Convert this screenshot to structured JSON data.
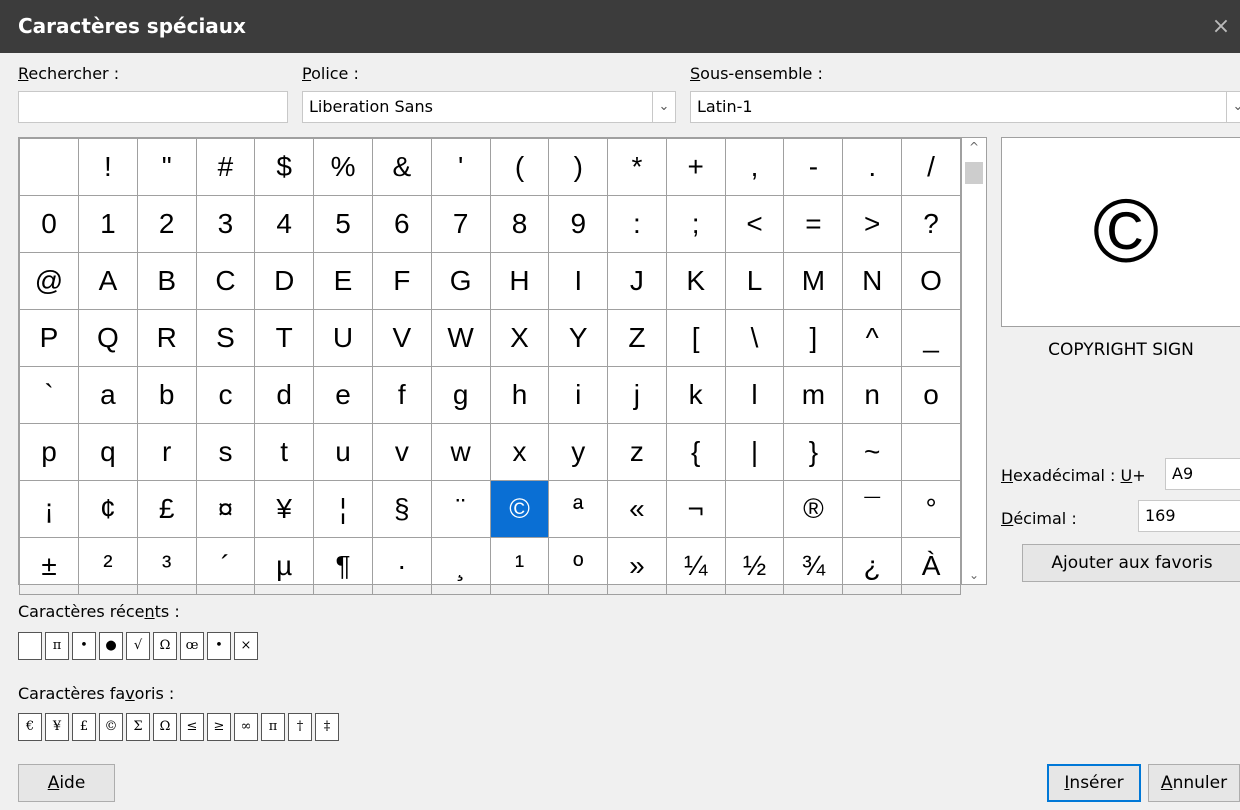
{
  "window": {
    "title": "Caractères spéciaux",
    "close_glyph": "×"
  },
  "search": {
    "label_pre": "",
    "label_u": "R",
    "label_post": "echercher :",
    "value": ""
  },
  "font": {
    "label_u": "P",
    "label_post": "olice :",
    "value": "Liberation Sans",
    "arrow": "⌄"
  },
  "subset": {
    "label_u": "S",
    "label_post": "ous-ensemble :",
    "value": "Latin-1",
    "arrow": "⌄"
  },
  "grid": {
    "rows": [
      [
        " ",
        "!",
        "\"",
        "#",
        "$",
        "%",
        "&",
        "'",
        "(",
        ")",
        "*",
        "+",
        ",",
        "-",
        ".",
        "/"
      ],
      [
        "0",
        "1",
        "2",
        "3",
        "4",
        "5",
        "6",
        "7",
        "8",
        "9",
        ":",
        ";",
        "<",
        "=",
        ">",
        "?"
      ],
      [
        "@",
        "A",
        "B",
        "C",
        "D",
        "E",
        "F",
        "G",
        "H",
        "I",
        "J",
        "K",
        "L",
        "M",
        "N",
        "O"
      ],
      [
        "P",
        "Q",
        "R",
        "S",
        "T",
        "U",
        "V",
        "W",
        "X",
        "Y",
        "Z",
        "[",
        "\\",
        "]",
        "^",
        "_"
      ],
      [
        "`",
        "a",
        "b",
        "c",
        "d",
        "e",
        "f",
        "g",
        "h",
        "i",
        "j",
        "k",
        "l",
        "m",
        "n",
        "o"
      ],
      [
        "p",
        "q",
        "r",
        "s",
        "t",
        "u",
        "v",
        "w",
        "x",
        "y",
        "z",
        "{",
        "|",
        "}",
        "~",
        ""
      ],
      [
        "¡",
        "¢",
        "£",
        "¤",
        "¥",
        "¦",
        "§",
        "¨",
        "©",
        "ª",
        "«",
        "¬",
        "",
        "®",
        "¯",
        "°"
      ],
      [
        "±",
        "²",
        "³",
        "´",
        "µ",
        "¶",
        "·",
        "¸",
        "¹",
        "º",
        "»",
        "¼",
        "½",
        "¾",
        "¿",
        "À"
      ]
    ],
    "selected": "©",
    "scroll_up": "^",
    "scroll_down": "⌄"
  },
  "preview": {
    "char": "©",
    "name": "COPYRIGHT SIGN"
  },
  "hex": {
    "label_u": "H",
    "label_post": "exadécimal : ",
    "prefix_u": "U",
    "prefix_post": "+",
    "value": "A9"
  },
  "decimal": {
    "label_u": "D",
    "label_post": "écimal :",
    "value": "169"
  },
  "add_favorite_label": "Ajouter aux favoris",
  "recent": {
    "label_pre": "Caractères réce",
    "label_u": "n",
    "label_post": "ts :",
    "chars": [
      " ",
      "π",
      "•",
      "●",
      "√",
      "Ω",
      "œ",
      "•",
      "×"
    ]
  },
  "favorites": {
    "label_pre": "Caractères fa",
    "label_u": "v",
    "label_post": "oris :",
    "chars": [
      "€",
      "¥",
      "£",
      "©",
      "Σ",
      "Ω",
      "≤",
      "≥",
      "∞",
      "π",
      "†",
      "‡"
    ]
  },
  "buttons": {
    "help": {
      "u": "A",
      "post": "ide"
    },
    "insert": {
      "u": "I",
      "post": "nsérer"
    },
    "cancel": {
      "u": "A",
      "post": "nnuler"
    }
  },
  "colors": {
    "selection": "#0a6fd4",
    "titlebar": "#3c3c3c",
    "focus": "#0078d7"
  }
}
